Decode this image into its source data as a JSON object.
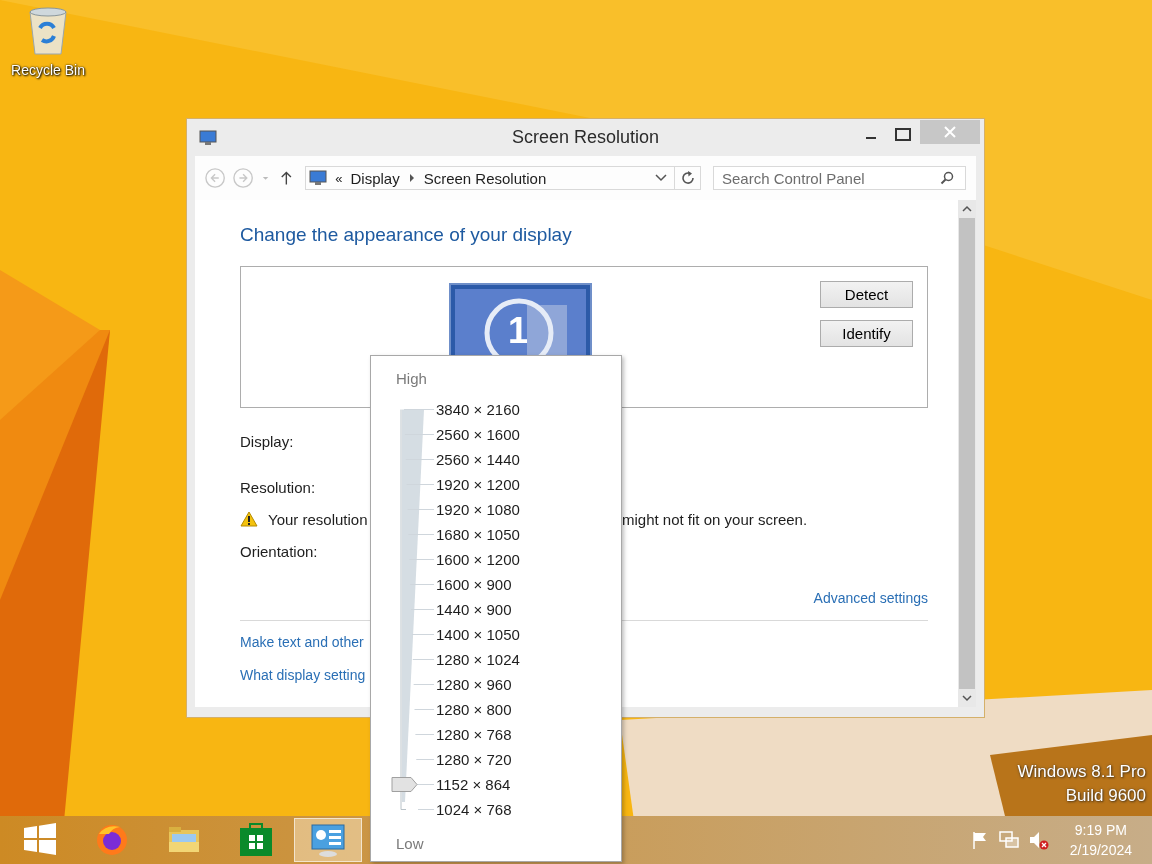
{
  "desktop": {
    "icons": [
      {
        "label": "Recycle Bin"
      }
    ],
    "edition": [
      "Windows 8.1 Pro",
      "Build 9600"
    ]
  },
  "window": {
    "title": "Screen Resolution",
    "nav": {
      "back_disabled": true,
      "forward_disabled": true,
      "overflow": "«",
      "crumbs": [
        "Display",
        "Screen Resolution"
      ],
      "search": {
        "placeholder": "Search Control Panel"
      }
    },
    "heading": "Change the appearance of your display",
    "monitor": {
      "number": "1"
    },
    "buttons": [
      "Detect",
      "Identify"
    ],
    "fields": [
      "Display:",
      "Resolution:"
    ],
    "warning": [
      "Your resolution",
      "might not fit on your screen."
    ],
    "orientation": "Orientation:",
    "advanced_link": "Advanced settings",
    "links": [
      "Make text and other",
      "What display setting"
    ]
  },
  "resolution_menu": {
    "high": "High",
    "low": "Low",
    "options": [
      {
        "label": "3840 × 2160",
        "selected": false
      },
      {
        "label": "2560 × 1600",
        "selected": false
      },
      {
        "label": "2560 × 1440",
        "selected": false
      },
      {
        "label": "1920 × 1200",
        "selected": false
      },
      {
        "label": "1920 × 1080",
        "selected": false
      },
      {
        "label": "1680 × 1050",
        "selected": false
      },
      {
        "label": "1600 × 1200",
        "selected": false
      },
      {
        "label": "1600 × 900",
        "selected": false
      },
      {
        "label": "1440 × 900",
        "selected": false
      },
      {
        "label": "1400 × 1050",
        "selected": false
      },
      {
        "label": "1280 × 1024",
        "selected": false
      },
      {
        "label": "1280 × 960",
        "selected": false
      },
      {
        "label": "1280 × 800",
        "selected": false
      },
      {
        "label": "1280 × 768",
        "selected": false
      },
      {
        "label": "1280 × 720",
        "selected": false
      },
      {
        "label": "1152 × 864",
        "selected": true
      },
      {
        "label": "1024 × 768",
        "selected": false
      }
    ]
  },
  "taskbar": {
    "items": [
      {
        "kind": "start",
        "selected": false
      },
      {
        "kind": "browser",
        "selected": false
      },
      {
        "kind": "folder",
        "selected": false
      },
      {
        "kind": "store",
        "selected": false
      },
      {
        "kind": "control-panel",
        "selected": true
      }
    ],
    "tray": {
      "time": "9:19 PM",
      "date": "2/19/2024"
    }
  }
}
